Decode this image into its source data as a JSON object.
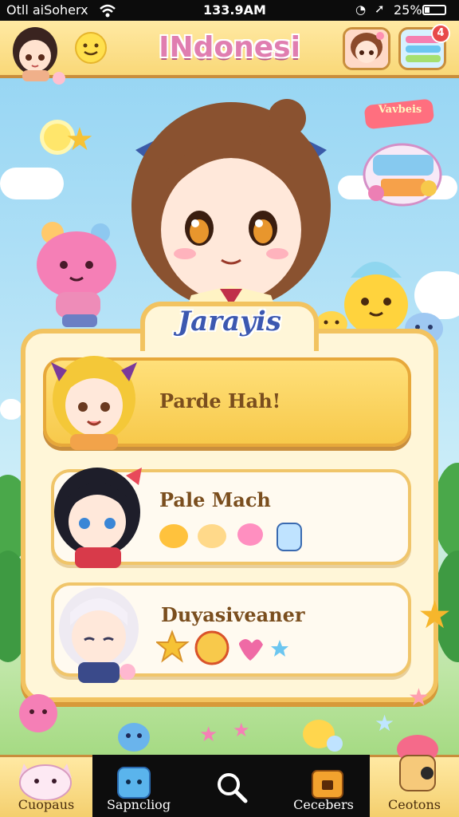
{
  "status_bar": {
    "carrier": "Otll aiSoherx",
    "time": "133.9AM",
    "battery": "25%"
  },
  "header": {
    "title": "INdonesi",
    "notification_count": "4"
  },
  "promo_sign": "Vavbeis",
  "panel": {
    "title": "Jarayis",
    "cards": [
      {
        "label": "Parde Hah!",
        "selected": true
      },
      {
        "label": "Pale Mach",
        "selected": false
      },
      {
        "label": "Duyasiveaner",
        "selected": false
      }
    ]
  },
  "bottom_nav": [
    {
      "label": "Cuopaus",
      "icon": "cat-icon"
    },
    {
      "label": "Sapncliog",
      "icon": "bot-icon"
    },
    {
      "label": "",
      "icon": "search-icon"
    },
    {
      "label": "Cecebers",
      "icon": "chest-icon"
    },
    {
      "label": "Ceotons",
      "icon": "mascot-icon"
    }
  ],
  "colors": {
    "header_bg": "#f9d878",
    "title_pink": "#e07eb0",
    "panel_border": "#f2c360",
    "panel_title_blue": "#3c58b0",
    "selected_card": "#f7c94b"
  }
}
